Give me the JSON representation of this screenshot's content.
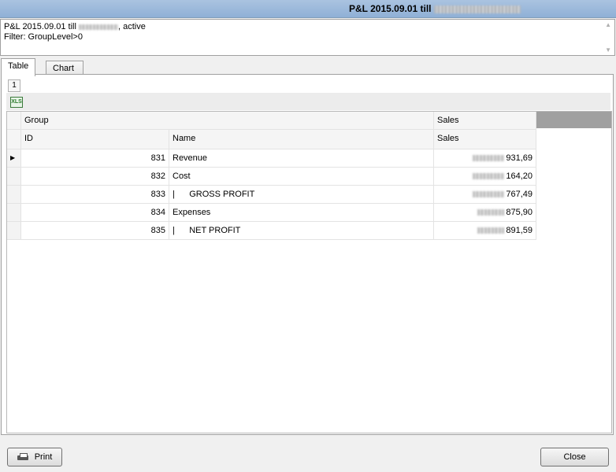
{
  "window": {
    "title": "P&L 2015.09.01 till",
    "title_redacted": true
  },
  "info": {
    "line1_prefix": "P&L 2015.09.01 till",
    "line1_suffix": ", active",
    "line2": "Filter: GroupLevel>0"
  },
  "tabs": [
    {
      "label": "Table",
      "active": true
    },
    {
      "label": "Chart",
      "active": false
    }
  ],
  "page_number": "1",
  "toolbar": {
    "export_icon": "xls-icon",
    "export_label": "XLS"
  },
  "grid": {
    "header_row1": {
      "group": "Group",
      "sales": "Sales"
    },
    "header_row2": {
      "id": "ID",
      "name": "Name",
      "sales": "Sales"
    },
    "rows": [
      {
        "id": "831",
        "name": "Revenue",
        "sales": "931,69",
        "current": true
      },
      {
        "id": "832",
        "name": "Cost",
        "sales": "164,20",
        "current": false
      },
      {
        "id": "833",
        "name": "|      GROSS PROFIT",
        "sales": "767,49",
        "current": false
      },
      {
        "id": "834",
        "name": "Expenses",
        "sales": "875,90",
        "current": false
      },
      {
        "id": "835",
        "name": "|      NET PROFIT",
        "sales": "891,59",
        "current": false
      }
    ]
  },
  "buttons": {
    "print": "Print",
    "close": "Close"
  }
}
